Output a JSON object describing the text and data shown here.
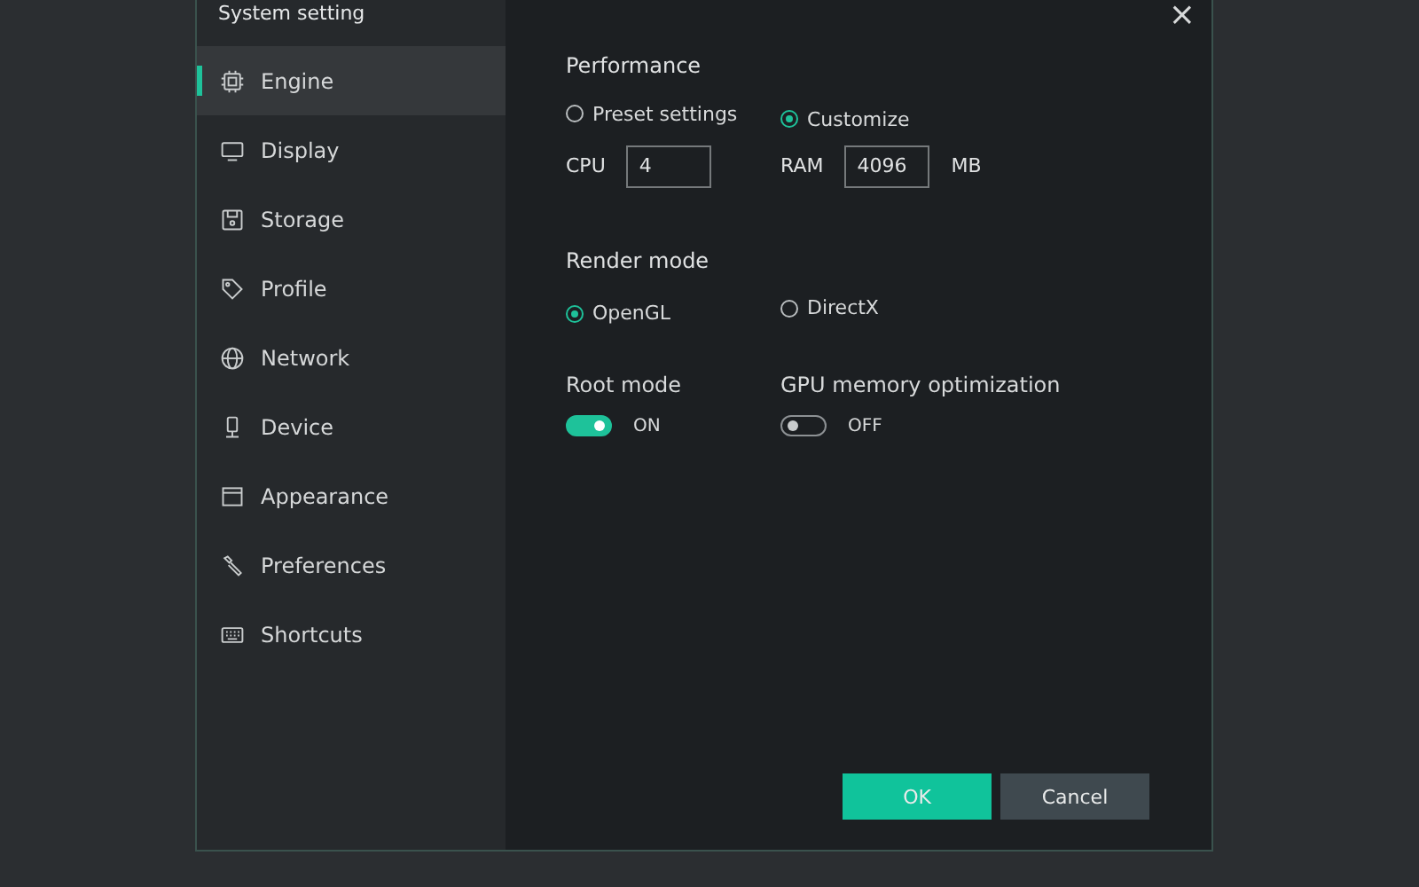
{
  "window": {
    "title": "System setting",
    "close": "×"
  },
  "sidebar": {
    "items": [
      {
        "label": "Engine",
        "selected": true
      },
      {
        "label": "Display",
        "selected": false
      },
      {
        "label": "Storage",
        "selected": false
      },
      {
        "label": "Profile",
        "selected": false
      },
      {
        "label": "Network",
        "selected": false
      },
      {
        "label": "Device",
        "selected": false
      },
      {
        "label": "Appearance",
        "selected": false
      },
      {
        "label": "Preferences",
        "selected": false
      },
      {
        "label": "Shortcuts",
        "selected": false
      }
    ]
  },
  "performance": {
    "heading": "Performance",
    "options": [
      {
        "label": "Preset settings",
        "selected": false
      },
      {
        "label": "Customize",
        "selected": true
      }
    ],
    "cpu": {
      "label": "CPU",
      "value": "4"
    },
    "ram": {
      "label": "RAM",
      "value": "4096",
      "unit": "MB"
    }
  },
  "render_mode": {
    "heading": "Render mode",
    "options": [
      {
        "label": "OpenGL",
        "selected": true
      },
      {
        "label": "DirectX",
        "selected": false
      }
    ]
  },
  "toggles": [
    {
      "heading": "Root mode",
      "on": true,
      "state_label": "ON"
    },
    {
      "heading": "GPU memory optimization",
      "on": false,
      "state_label": "OFF"
    }
  ],
  "buttons": [
    {
      "label": "OK",
      "kind": "primary"
    },
    {
      "label": "Cancel",
      "kind": "secondary"
    }
  ]
}
